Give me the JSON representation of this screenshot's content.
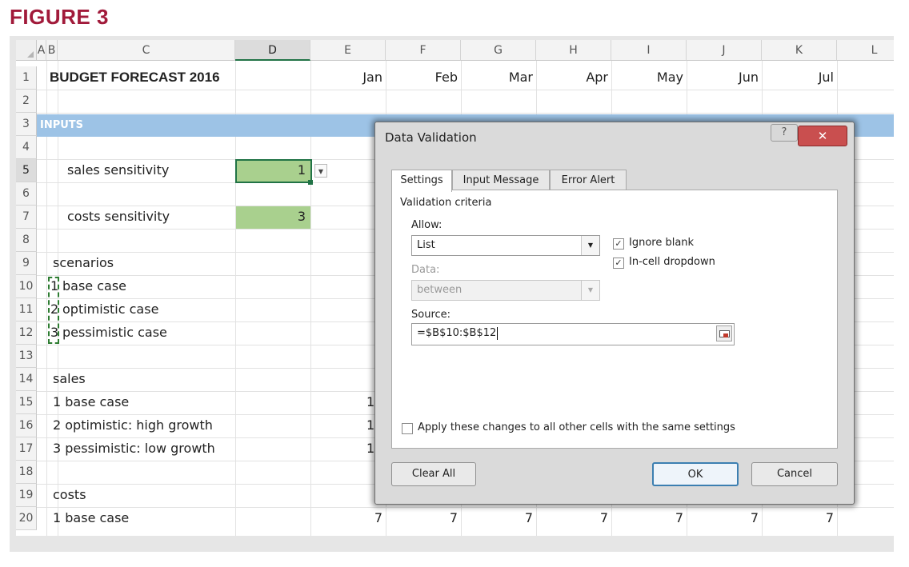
{
  "figure_label": "FIGURE 3",
  "columns": [
    "A",
    "B",
    "C",
    "D",
    "E",
    "F",
    "G",
    "H",
    "I",
    "J",
    "K",
    "L"
  ],
  "rows": [
    "1",
    "2",
    "3",
    "4",
    "5",
    "6",
    "7",
    "8",
    "9",
    "10",
    "11",
    "12",
    "13",
    "14",
    "15",
    "16",
    "17",
    "18",
    "19",
    "20"
  ],
  "cells": {
    "title": "BUDGET FORECAST 2016",
    "months": [
      "Jan",
      "Feb",
      "Mar",
      "Apr",
      "May",
      "Jun",
      "Jul"
    ],
    "inputs": "INPUTS",
    "sales_sensitivity": "sales sensitivity",
    "sales_sensitivity_value": "1",
    "costs_sensitivity": "costs sensitivity",
    "costs_sensitivity_value": "3",
    "scenarios": "scenarios",
    "scenario_nums": [
      "1",
      "2",
      "3"
    ],
    "scenario_names": [
      "base case",
      "optimistic case",
      "pessimistic case"
    ],
    "sales": "sales",
    "sales_rows": [
      "1 base case",
      "2 optimistic: high growth",
      "3 pessimistic: low growth"
    ],
    "sales_partial": [
      "1",
      "1",
      "1"
    ],
    "costs": "costs",
    "costs_row": "1 base case",
    "costs_values": [
      "7",
      "7",
      "7",
      "7",
      "7",
      "7",
      "7"
    ]
  },
  "dialog": {
    "title": "Data Validation",
    "help_label": "?",
    "close_label": "✕",
    "tabs": [
      "Settings",
      "Input Message",
      "Error Alert"
    ],
    "criteria_label": "Validation criteria",
    "allow_label": "Allow:",
    "allow_value": "List",
    "data_label": "Data:",
    "data_value": "between",
    "ignore_blank_label": "Ignore blank",
    "ignore_blank_checked": true,
    "incell_dropdown_label": "In-cell dropdown",
    "incell_dropdown_checked": true,
    "source_label": "Source:",
    "source_value": "=$B$10:$B$12",
    "apply_all_label": "Apply these changes to all other cells with the same settings",
    "apply_all_checked": false,
    "clear_all_label": "Clear All",
    "ok_label": "OK",
    "cancel_label": "Cancel"
  },
  "icons": {
    "dropdown_arrow": "chevron-down-icon",
    "checkmark": "check-icon",
    "range_selector": "collapse-dialog-icon"
  },
  "colors": {
    "figure_label": "#a11a3a",
    "inputs_band": "#9dc3e6",
    "input_cell": "#a9d08e",
    "selection": "#217346",
    "close_button": "#c94f4f"
  }
}
